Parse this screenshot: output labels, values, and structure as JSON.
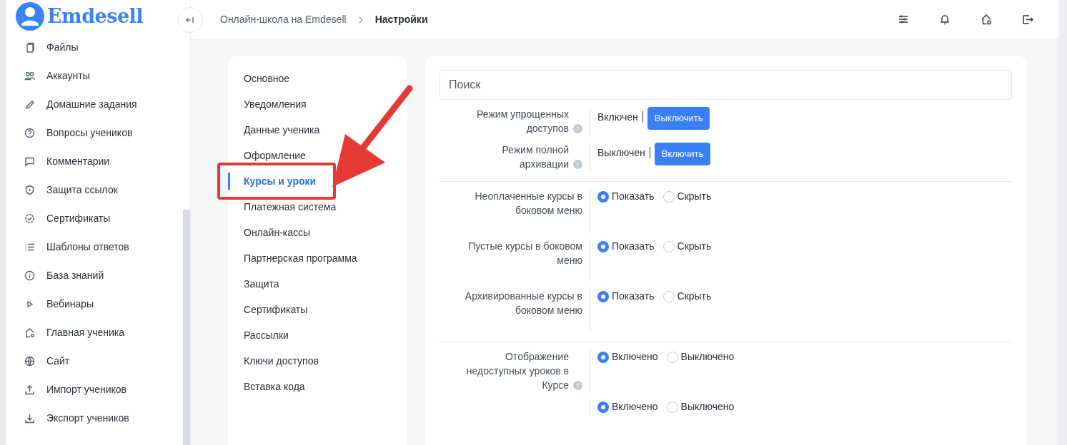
{
  "logo": {
    "text": "Emdesell"
  },
  "sidebar": {
    "items": [
      {
        "label": "Файлы"
      },
      {
        "label": "Аккаунты"
      },
      {
        "label": "Домашние задания"
      },
      {
        "label": "Вопросы учеников"
      },
      {
        "label": "Комментарии"
      },
      {
        "label": "Защита ссылок"
      },
      {
        "label": "Сертификаты"
      },
      {
        "label": "Шаблоны ответов"
      },
      {
        "label": "База знаний"
      },
      {
        "label": "Вебинары"
      },
      {
        "label": "Главная ученика"
      },
      {
        "label": "Сайт"
      },
      {
        "label": "Импорт учеников"
      },
      {
        "label": "Экспорт учеников"
      }
    ]
  },
  "breadcrumb": [
    {
      "label": "Онлайн-школа на Emdesell",
      "current": false
    },
    {
      "label": "Настройки",
      "current": true
    }
  ],
  "settings_menu": [
    {
      "label": "Основное",
      "selected": false,
      "highlighted": false
    },
    {
      "label": "Уведомления",
      "selected": false,
      "highlighted": false
    },
    {
      "label": "Данные ученика",
      "selected": false,
      "highlighted": false
    },
    {
      "label": "Оформление",
      "selected": false,
      "highlighted": false
    },
    {
      "label": "Курсы и уроки",
      "selected": true,
      "highlighted": true
    },
    {
      "label": "Платежная система",
      "selected": false,
      "highlighted": false
    },
    {
      "label": "Онлайн-кассы",
      "selected": false,
      "highlighted": false
    },
    {
      "label": "Партнерская программа",
      "selected": false,
      "highlighted": false
    },
    {
      "label": "Защита",
      "selected": false,
      "highlighted": false
    },
    {
      "label": "Сертификаты",
      "selected": false,
      "highlighted": false
    },
    {
      "label": "Рассылки",
      "selected": false,
      "highlighted": false
    },
    {
      "label": "Ключи доступов",
      "selected": false,
      "highlighted": false
    },
    {
      "label": "Вставка кода",
      "selected": false,
      "highlighted": false
    }
  ],
  "search": {
    "placeholder": "Поиск"
  },
  "settings": [
    {
      "kind": "toggle",
      "label": "Режим упрощенных доступов",
      "info": true,
      "status": "Включен",
      "button": "Выключить"
    },
    {
      "kind": "toggle",
      "label": "Режим полной архивации",
      "info": true,
      "status": "Выключен",
      "button": "Включить"
    },
    {
      "kind": "divider"
    },
    {
      "kind": "radio",
      "label": "Неоплаченные курсы в боковом меню",
      "info": false,
      "options": [
        {
          "label": "Показать",
          "selected": true
        },
        {
          "label": "Скрыть",
          "selected": false
        }
      ]
    },
    {
      "kind": "radio",
      "label": "Пустые курсы в боковом меню",
      "info": false,
      "options": [
        {
          "label": "Показать",
          "selected": true
        },
        {
          "label": "Скрыть",
          "selected": false
        }
      ]
    },
    {
      "kind": "radio",
      "label": "Архивированные курсы в боковом меню",
      "info": false,
      "options": [
        {
          "label": "Показать",
          "selected": true
        },
        {
          "label": "Скрыть",
          "selected": false
        }
      ]
    },
    {
      "kind": "divider"
    },
    {
      "kind": "radio",
      "label": "Отображение недоступных уроков в Курсе",
      "info": true,
      "options": [
        {
          "label": "Включено",
          "selected": true
        },
        {
          "label": "Выключено",
          "selected": false
        }
      ]
    },
    {
      "kind": "radio",
      "info": false,
      "options": [
        {
          "label": "Включено",
          "selected": true
        },
        {
          "label": "Выключено",
          "selected": false
        }
      ]
    }
  ]
}
